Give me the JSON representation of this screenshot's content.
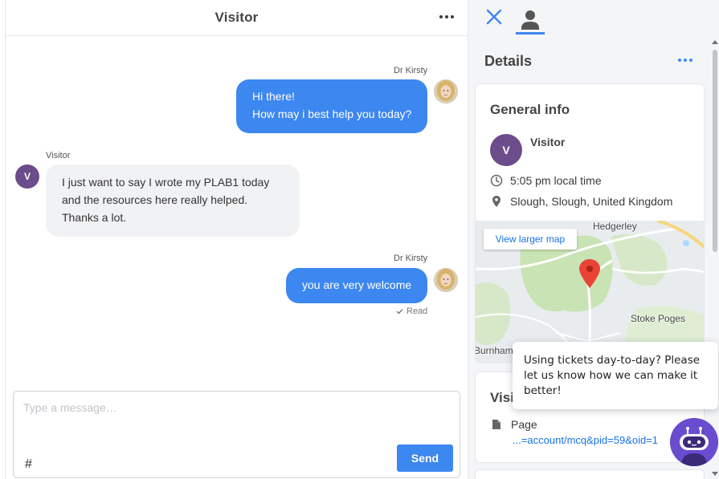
{
  "chat": {
    "title": "Visitor",
    "messages": [
      {
        "sender": "Dr Kirsty",
        "lines": [
          "Hi there!",
          "How may i best help you today?"
        ]
      },
      {
        "sender": "Visitor",
        "avatar_initial": "V",
        "lines": [
          "I just want to say I wrote my PLAB1 today",
          "and the resources here really helped.",
          "Thanks a lot."
        ]
      },
      {
        "sender": "Dr Kirsty",
        "lines": [
          "you are very welcome"
        ],
        "status": "Read"
      }
    ],
    "composer": {
      "placeholder": "Type a message…",
      "value": "",
      "hash_label": "#",
      "send_label": "Send"
    }
  },
  "details": {
    "title": "Details",
    "general": {
      "title": "General info",
      "avatar_initial": "V",
      "name": "Visitor",
      "local_time": "5:05 pm local time",
      "location": "Slough, Slough, United Kingdom",
      "map": {
        "view_larger_label": "View larger map",
        "labels": {
          "top": "Hedgerley",
          "right": "Stoke Poges",
          "left": "Burnham"
        }
      }
    },
    "visit": {
      "title": "Visit",
      "page_label": "Page",
      "page_url": "...=account/mcq&pid=59&oid=1"
    }
  },
  "popup": {
    "text": "Using tickets day-to-day? Please let us know how we can make it better!"
  },
  "colors": {
    "accent": "#3d87f0",
    "visitor_avatar": "#6c4c8a",
    "bot": "#6a4ccf"
  }
}
